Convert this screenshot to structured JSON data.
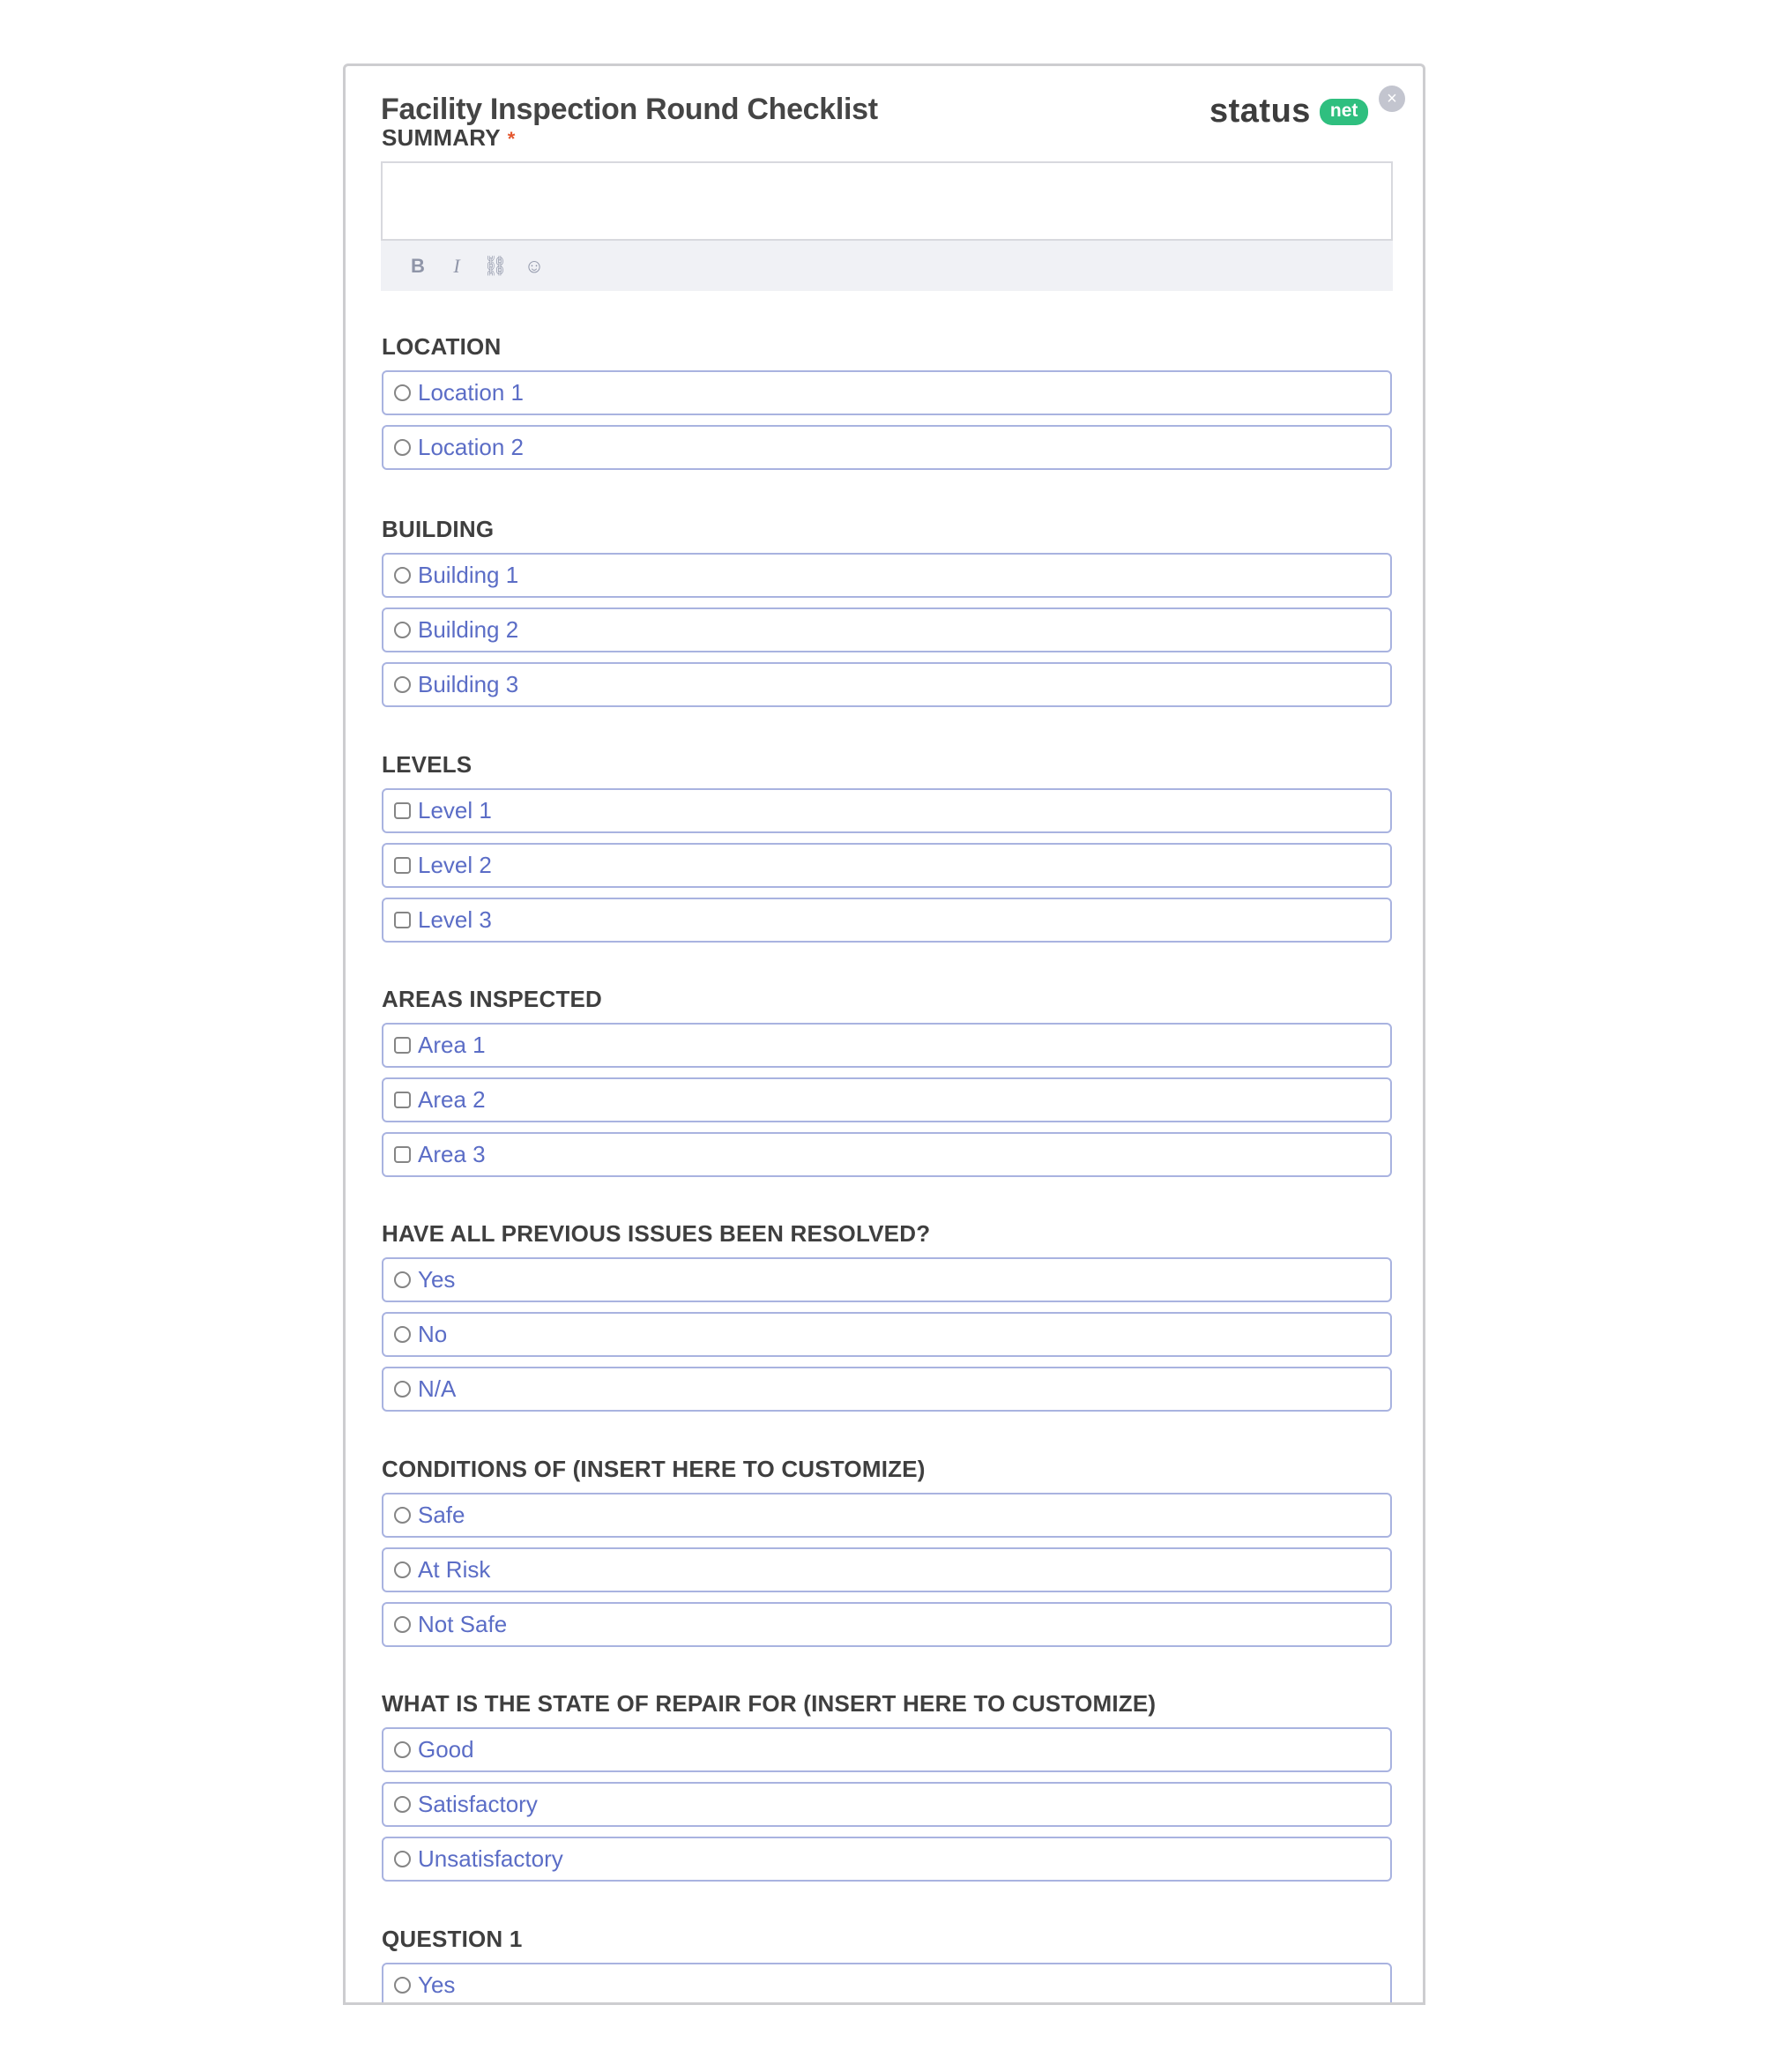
{
  "form": {
    "title": "Facility Inspection Round Checklist",
    "close_icon": "close-icon",
    "logo": {
      "word": "status",
      "pill": "net",
      "pill_color": "#2fbf7f"
    },
    "summary": {
      "label": "SUMMARY",
      "required_marker": "*",
      "value": "",
      "toolbar": [
        {
          "icon": "bold-icon",
          "glyph": "B"
        },
        {
          "icon": "italic-icon",
          "glyph": "I"
        },
        {
          "icon": "link-icon",
          "glyph": "⛓"
        },
        {
          "icon": "emoji-icon",
          "glyph": "☺"
        }
      ]
    },
    "sections": [
      {
        "label": "LOCATION",
        "type": "radio",
        "options": [
          "Location 1",
          "Location 2"
        ]
      },
      {
        "label": "BUILDING",
        "type": "radio",
        "options": [
          "Building 1",
          "Building 2",
          "Building 3"
        ]
      },
      {
        "label": "LEVELS",
        "type": "checkbox",
        "options": [
          "Level 1",
          "Level 2",
          "Level 3"
        ]
      },
      {
        "label": "AREAS INSPECTED",
        "type": "checkbox",
        "options": [
          "Area 1",
          "Area 2",
          "Area 3"
        ]
      },
      {
        "label": "HAVE ALL PREVIOUS ISSUES BEEN RESOLVED?",
        "type": "radio",
        "options": [
          "Yes",
          "No",
          "N/A"
        ]
      },
      {
        "label": "CONDITIONS OF (INSERT HERE TO CUSTOMIZE)",
        "type": "radio",
        "options": [
          "Safe",
          "At Risk",
          "Not Safe"
        ]
      },
      {
        "label": "WHAT IS THE STATE OF REPAIR FOR (INSERT HERE TO CUSTOMIZE)",
        "type": "radio",
        "options": [
          "Good",
          "Satisfactory",
          "Unsatisfactory"
        ]
      },
      {
        "label": "QUESTION 1",
        "type": "radio",
        "options": [
          "Yes"
        ]
      }
    ]
  }
}
